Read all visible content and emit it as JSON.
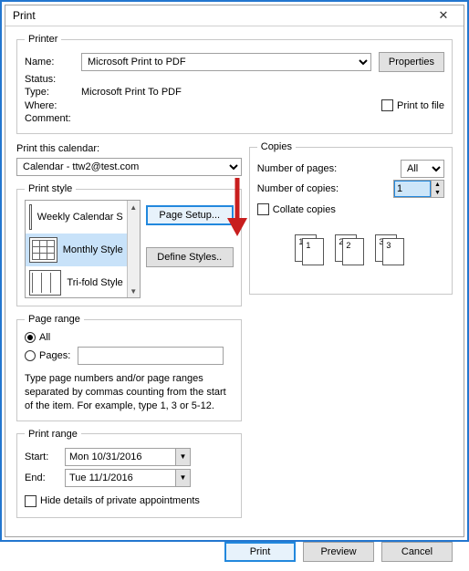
{
  "window": {
    "title": "Print",
    "close": "✕"
  },
  "printer": {
    "legend": "Printer",
    "name_label": "Name:",
    "name_value": "Microsoft Print to PDF",
    "properties_btn": "Properties",
    "status_label": "Status:",
    "type_label": "Type:",
    "type_value": "Microsoft Print To PDF",
    "where_label": "Where:",
    "comment_label": "Comment:",
    "print_to_file": "Print to file"
  },
  "calendar": {
    "label": "Print this calendar:",
    "value": "Calendar - ttw2@test.com"
  },
  "styles": {
    "legend": "Print style",
    "items": [
      {
        "label": "Weekly Calendar S"
      },
      {
        "label": "Monthly Style"
      },
      {
        "label": "Tri-fold Style"
      }
    ],
    "selected_index": 1,
    "page_setup_btn": "Page Setup...",
    "define_styles_btn": "Define Styles.."
  },
  "copies": {
    "legend": "Copies",
    "pages_label": "Number of pages:",
    "pages_value": "All",
    "copies_label": "Number of copies:",
    "copies_value": "1",
    "collate_label": "Collate copies",
    "sheet_labels": [
      "1",
      "2",
      "3"
    ]
  },
  "page_range": {
    "legend": "Page range",
    "all_label": "All",
    "pages_label": "Pages:",
    "selected": "all",
    "help": "Type page numbers and/or page ranges separated by commas counting from the start of the item.  For example, type 1, 3 or 5-12."
  },
  "print_range": {
    "legend": "Print range",
    "start_label": "Start:",
    "start_value": "Mon 10/31/2016",
    "end_label": "End:",
    "end_value": "Tue 11/1/2016",
    "hide_private": "Hide details of private appointments"
  },
  "footer": {
    "print": "Print",
    "preview": "Preview",
    "cancel": "Cancel"
  }
}
